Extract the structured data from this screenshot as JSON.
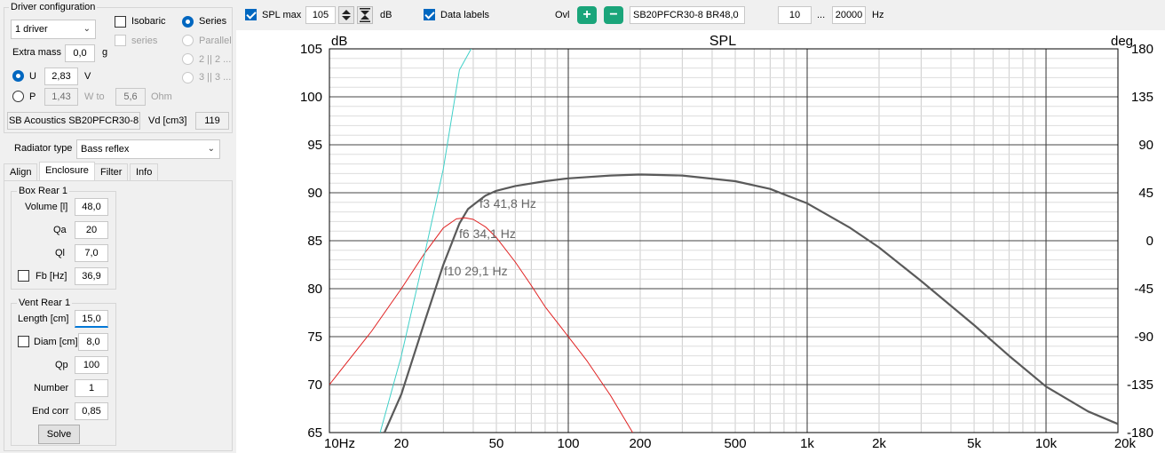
{
  "driver_config": {
    "title": "Driver configuration",
    "drivers_combo": "1 driver",
    "isobaric": "Isobaric",
    "series_check": "series",
    "series_radio": "Series",
    "parallel_radio": "Parallel",
    "p22": "2 || 2 ...",
    "p33": "3 || 3 ...",
    "extra_mass_label": "Extra mass",
    "extra_mass_value": "0,0",
    "extra_mass_unit": "g",
    "u_label": "U",
    "u_value": "2,83",
    "u_unit": "V",
    "p_label": "P",
    "p_value": "1,43",
    "w_to": "W to",
    "ohm_value": "5,6",
    "ohm_unit": "Ohm",
    "driver_name": "SB Acoustics SB20PFCR30-8",
    "vd_label": "Vd [cm3]",
    "vd_value": "119"
  },
  "radiator": {
    "label": "Radiator type",
    "value": "Bass reflex"
  },
  "tabs": [
    "Align",
    "Enclosure",
    "Filter",
    "Info"
  ],
  "box": {
    "title": "Box Rear 1",
    "volume_label": "Volume [l]",
    "volume_value": "48,0",
    "qa_label": "Qa",
    "qa_value": "20",
    "ql_label": "Ql",
    "ql_value": "7,0",
    "fb_label": "Fb [Hz]",
    "fb_value": "36,9"
  },
  "vent": {
    "title": "Vent Rear 1",
    "length_label": "Length [cm]",
    "length_value": "15,0",
    "diam_label": "Diam [cm]",
    "diam_value": "8,0",
    "qp_label": "Qp",
    "qp_value": "100",
    "number_label": "Number",
    "number_value": "1",
    "endcorr_label": "End corr",
    "endcorr_value": "0,85",
    "solve_label": "Solve"
  },
  "toolbar": {
    "spl_max_label": "SPL max",
    "spl_max_value": "105",
    "db_unit": "dB",
    "data_labels": "Data labels",
    "ovl_label": "Ovl",
    "plus": "+",
    "minus": "−",
    "overlay_name": "SB20PFCR30-8 BR48,0",
    "freq_from": "10",
    "ellipsis": "...",
    "freq_to": "20000",
    "hz_unit": "Hz"
  },
  "colors": {
    "spl": "#5a5a5a",
    "phase": "#e02020",
    "impedance": "#40d0c8",
    "accent": "#0067c0"
  },
  "chart_data": {
    "type": "line",
    "title": "SPL",
    "ylabel_left": "dB",
    "ylabel_right": "deg",
    "x_scale": "log",
    "xlim": [
      10,
      20000
    ],
    "ylim": [
      65,
      105
    ],
    "ylim_right": [
      -180,
      180
    ],
    "x_ticks": [
      "10Hz",
      "20",
      "50",
      "100",
      "200",
      "500",
      "1k",
      "2k",
      "5k",
      "10k",
      "20k"
    ],
    "x_tick_values": [
      10,
      20,
      50,
      100,
      200,
      500,
      1000,
      2000,
      5000,
      10000,
      20000
    ],
    "y_ticks": [
      "105",
      "100",
      "95",
      "90",
      "85",
      "80",
      "75",
      "70",
      "65"
    ],
    "y_tick_values": [
      105,
      100,
      95,
      90,
      85,
      80,
      75,
      70,
      65
    ],
    "y2_ticks": [
      "180",
      "135",
      "90",
      "45",
      "0",
      "-45",
      "-90",
      "-135",
      "-180"
    ],
    "y2_tick_values": [
      180,
      135,
      90,
      45,
      0,
      -45,
      -90,
      -135,
      -180
    ],
    "grid": true,
    "series": [
      {
        "key": "spl",
        "x": [
          17,
          20,
          25,
          30,
          35,
          38,
          41.8,
          45,
          50,
          60,
          80,
          100,
          150,
          200,
          300,
          500,
          700,
          1000,
          1500,
          2000,
          3000,
          5000,
          7000,
          10000,
          15000,
          20000
        ],
        "y": [
          65,
          69,
          76.5,
          82.5,
          86.8,
          88.3,
          89.1,
          89.7,
          90.2,
          90.7,
          91.2,
          91.5,
          91.8,
          91.9,
          91.8,
          91.2,
          90.4,
          88.9,
          86.4,
          84.3,
          80.8,
          76.2,
          73.0,
          69.8,
          67.2,
          65.9
        ]
      },
      {
        "key": "phase",
        "x": [
          10,
          15,
          20,
          25,
          30,
          34,
          37,
          40,
          45,
          50,
          60,
          70,
          80,
          100,
          120,
          150,
          186
        ],
        "y": [
          -135,
          -85,
          -45,
          -12,
          12,
          20.5,
          21.5,
          20,
          13,
          3,
          -20,
          -42,
          -62,
          -90,
          -113,
          -145,
          -180
        ]
      },
      {
        "key": "impedance",
        "x": [
          16.3,
          20,
          25,
          30,
          35,
          40,
          45,
          50,
          55,
          60
        ],
        "y": [
          65,
          73,
          83.5,
          92.5,
          102.8,
          105.4,
          105.5,
          105.3,
          105.4,
          105.5
        ]
      }
    ],
    "annotations": [
      "f3 41,8 Hz",
      "f6 34,1 Hz",
      "f10 29,1 Hz"
    ]
  }
}
